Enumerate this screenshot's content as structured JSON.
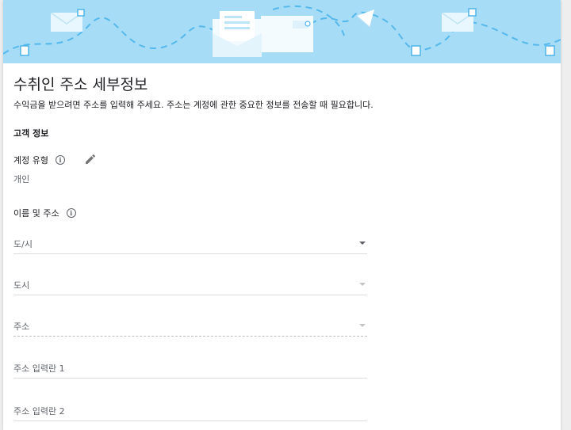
{
  "colors": {
    "banner_bg": "#a6dcf5",
    "accent": "#4fb3ea"
  },
  "page": {
    "title": "수취인 주소 세부정보",
    "subtitle": "수익금을 받으려면 주소를 입력해 주세요. 주소는 계정에 관한 중요한 정보를 전송할 때 필요합니다."
  },
  "customer": {
    "section_title": "고객 정보",
    "account_type_label": "계정 유형",
    "account_type_value": "개인",
    "name_address_label": "이름 및 주소"
  },
  "form": {
    "province_placeholder": "도/시",
    "city_placeholder": "도시",
    "address_placeholder": "주소",
    "address_line1_placeholder": "주소 입력란 1",
    "address_line2_placeholder": "주소 입력란 2"
  },
  "icons": {
    "info": "info-icon",
    "edit": "pencil-icon",
    "dropdown": "caret-down-icon"
  }
}
